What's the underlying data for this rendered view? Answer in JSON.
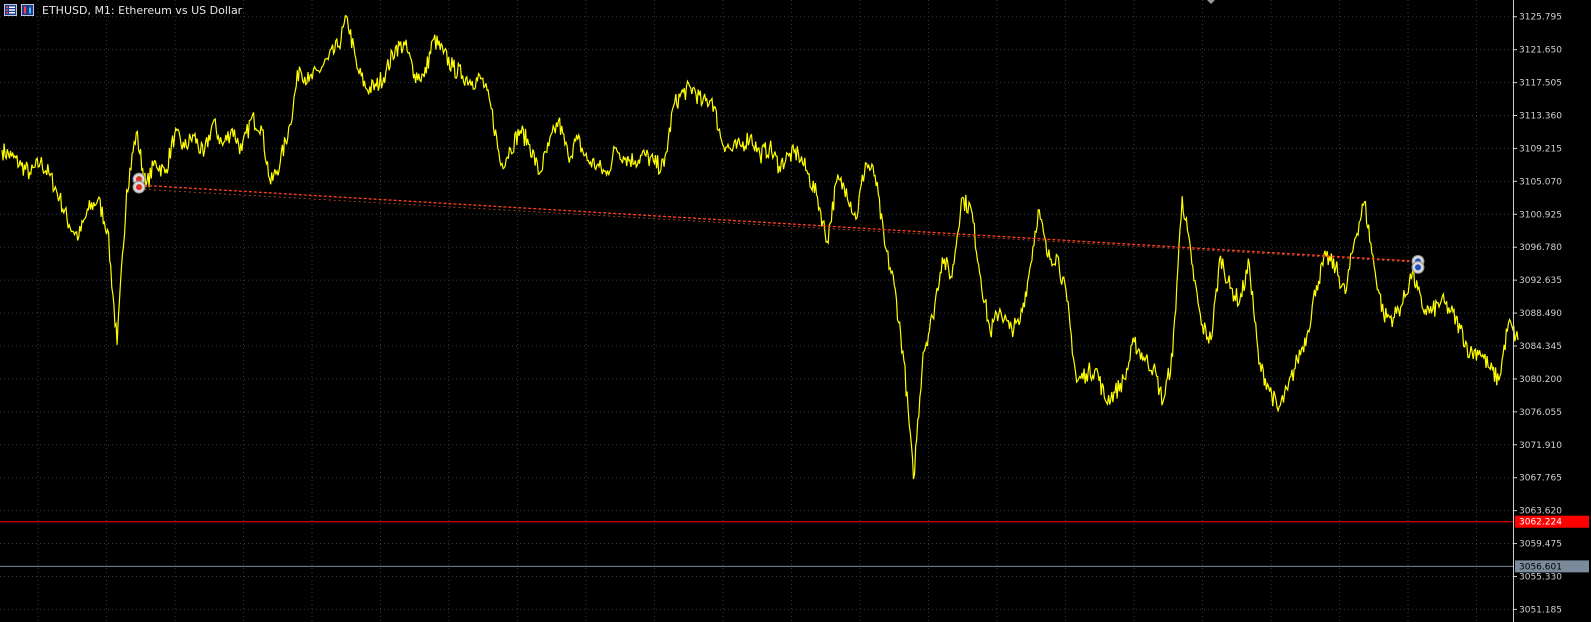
{
  "window": {
    "title": "ETHUSD, M1:  Ethereum vs US Dollar",
    "icons": [
      "chart-list-icon",
      "chart-type-icon"
    ]
  },
  "colors": {
    "background": "#000000",
    "grid": "#3a3a3a",
    "price_line": "#ffff00",
    "trade_line": "#ff4020",
    "level_line": "#ff0000",
    "bid_line": "#7a8a9a",
    "axis_text": "#d0d0d0"
  },
  "chart_data": {
    "type": "line",
    "symbol": "ETHUSD",
    "timeframe": "M1",
    "y_ticks": [
      "3125.795",
      "3121.650",
      "3117.505",
      "3113.360",
      "3109.215",
      "3105.070",
      "3100.925",
      "3096.780",
      "3092.635",
      "3088.490",
      "3084.345",
      "3080.200",
      "3076.055",
      "3071.910",
      "3067.765",
      "3063.620",
      "3059.475",
      "3055.330",
      "3051.185"
    ],
    "ylim": [
      3049.6,
      3127.9
    ],
    "price_levels": [
      {
        "name": "level-line",
        "value": "3062.224",
        "color": "#ff0000"
      },
      {
        "name": "bid-line",
        "value": "3056.601",
        "color": "#7a8a9a"
      }
    ],
    "trade_line": {
      "start_price": 3104.6,
      "end_price": 3095.0
    },
    "series": [
      {
        "values": [
          3109.0,
          3108.2,
          3107.1,
          3106.0,
          3107.5,
          3105.8,
          3103.0,
          3099.6,
          3098.1,
          3101.5,
          3102.8,
          3099.0,
          3084.5,
          3104.0,
          3111.2,
          3104.4,
          3107.6,
          3106.1,
          3111.0,
          3109.3,
          3110.8,
          3108.2,
          3112.5,
          3109.6,
          3111.7,
          3108.9,
          3113.0,
          3112.1,
          3104.7,
          3107.5,
          3112.2,
          3119.5,
          3117.6,
          3119.0,
          3120.4,
          3122.0,
          3125.6,
          3119.3,
          3116.7,
          3117.0,
          3118.8,
          3121.9,
          3122.2,
          3118.6,
          3118.2,
          3123.0,
          3121.2,
          3119.4,
          3118.4,
          3117.7,
          3118.0,
          3114.2,
          3107.1,
          3109.2,
          3111.5,
          3109.7,
          3106.0,
          3109.5,
          3112.7,
          3108.3,
          3110.3,
          3107.7,
          3107.1,
          3105.9,
          3109.3,
          3108.0,
          3107.7,
          3108.4,
          3107.3,
          3106.9,
          3114.6,
          3116.3,
          3116.8,
          3114.9,
          3115.5,
          3110.2,
          3109.0,
          3109.5,
          3110.8,
          3108.4,
          3109.3,
          3107.0,
          3108.3,
          3108.6,
          3106.0,
          3103.0,
          3097.5,
          3105.1,
          3104.2,
          3100.3,
          3107.4,
          3105.8,
          3097.0,
          3092.0,
          3082.5,
          3067.6,
          3083.5,
          3088.0,
          3095.5,
          3093.0,
          3102.9,
          3101.6,
          3093.0,
          3086.0,
          3089.0,
          3086.5,
          3087.0,
          3093.1,
          3101.5,
          3095.5,
          3095.7,
          3090.0,
          3079.8,
          3080.9,
          3081.5,
          3077.5,
          3078.5,
          3080.2,
          3084.8,
          3082.9,
          3081.6,
          3077.3,
          3083.1,
          3103.2,
          3094.7,
          3087.0,
          3085.1,
          3095.7,
          3091.6,
          3090.0,
          3094.7,
          3082.1,
          3079.3,
          3076.2,
          3078.8,
          3082.6,
          3085.7,
          3092.0,
          3095.6,
          3094.2,
          3090.9,
          3097.9,
          3102.5,
          3094.4,
          3088.2,
          3087.9,
          3089.8,
          3093.7,
          3089.2,
          3088.6,
          3090.0,
          3088.7,
          3086.5,
          3083.4,
          3083.8,
          3081.6,
          3080.0,
          3087.2,
          3085.1
        ]
      }
    ]
  }
}
